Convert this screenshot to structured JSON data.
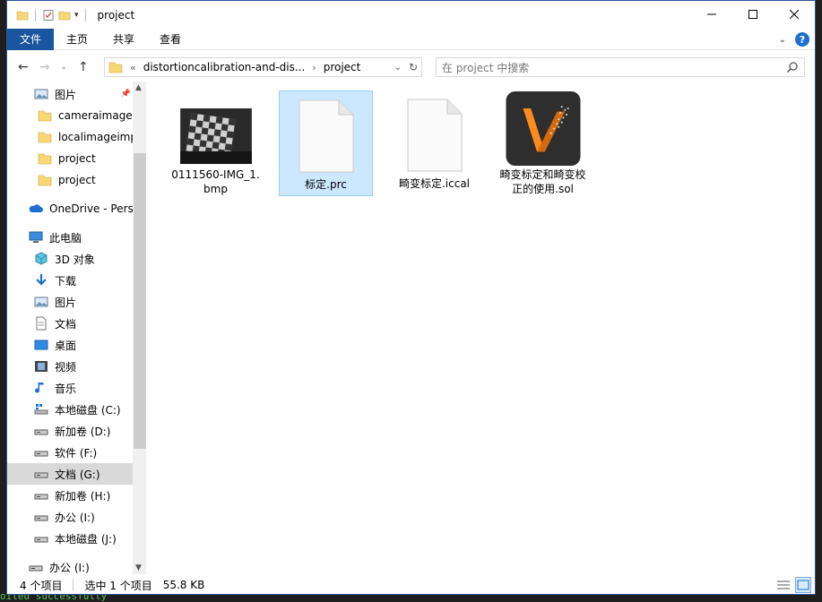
{
  "window": {
    "title": "project"
  },
  "ribbon": {
    "tabs": [
      "文件",
      "主页",
      "共享",
      "查看"
    ]
  },
  "address": {
    "root_chevron": "«",
    "segments": [
      "distortioncalibration-and-dis...",
      "project"
    ],
    "search_placeholder": "在 project 中搜索"
  },
  "sidebar": {
    "items": [
      {
        "label": "图片",
        "icon": "pictures-icon",
        "pinned": true
      },
      {
        "label": "cameraimagec",
        "icon": "folder-icon"
      },
      {
        "label": "localimageimp",
        "icon": "folder-icon"
      },
      {
        "label": "project",
        "icon": "folder-icon"
      },
      {
        "label": "project",
        "icon": "folder-icon"
      },
      {
        "label": "OneDrive - Perso",
        "icon": "onedrive-icon"
      },
      {
        "label": "此电脑",
        "icon": "this-pc-icon"
      },
      {
        "label": "3D 对象",
        "icon": "3d-objects-icon"
      },
      {
        "label": "下载",
        "icon": "downloads-icon"
      },
      {
        "label": "图片",
        "icon": "pictures-icon"
      },
      {
        "label": "文档",
        "icon": "documents-icon"
      },
      {
        "label": "桌面",
        "icon": "desktop-icon"
      },
      {
        "label": "视频",
        "icon": "videos-icon"
      },
      {
        "label": "音乐",
        "icon": "music-icon"
      },
      {
        "label": "本地磁盘 (C:)",
        "icon": "system-drive-icon"
      },
      {
        "label": "新加卷 (D:)",
        "icon": "drive-icon"
      },
      {
        "label": "软件 (F:)",
        "icon": "drive-icon"
      },
      {
        "label": "文档 (G:)",
        "icon": "drive-icon",
        "selected": true
      },
      {
        "label": "新加卷 (H:)",
        "icon": "drive-icon"
      },
      {
        "label": "办公 (I:)",
        "icon": "drive-icon"
      },
      {
        "label": "本地磁盘 (J:)",
        "icon": "drive-icon"
      },
      {
        "label": "办公 (I:)",
        "icon": "drive-icon"
      }
    ]
  },
  "files": [
    {
      "name": "0111560-IMG_1.bmp",
      "type": "bmp-thumbnail"
    },
    {
      "name": "标定.prc",
      "type": "generic-file",
      "selected": true
    },
    {
      "name": "畸变标定.iccal",
      "type": "generic-file"
    },
    {
      "name": "畸变标定和畸变校正的使用.sol",
      "type": "app-file"
    }
  ],
  "status": {
    "count": "4 个项目",
    "selection": "选中 1 个项目",
    "size": "55.8 KB"
  },
  "terminal": {
    "text": "oiled successfully"
  },
  "colors": {
    "accent": "#19569f",
    "selection": "#cce8ff",
    "folder": "#f8d775"
  }
}
